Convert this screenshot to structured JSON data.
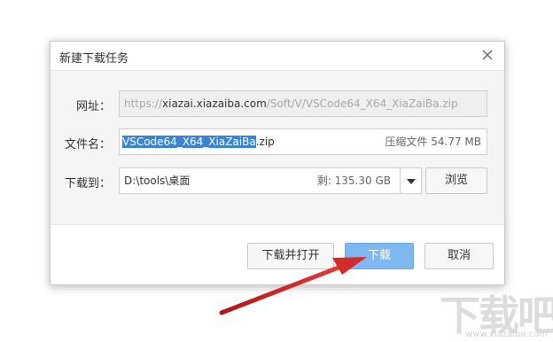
{
  "dialog": {
    "title": "新建下载任务"
  },
  "url_row": {
    "label": "网址：",
    "scheme": "https://",
    "host": "xiazai.xiazaiba.com",
    "path": "/Soft/V/VSCode64_X64_XiaZaiBa.zip"
  },
  "filename_row": {
    "label": "文件名：",
    "name_selected": "VSCode64_X64_XiaZaiBa",
    "extension": ".zip",
    "file_info": "压缩文件 54.77 MB"
  },
  "saveto_row": {
    "label": "下载到：",
    "path": "D:\\tools\\桌面",
    "free_space": "剩: 135.30 GB",
    "browse_label": "浏览"
  },
  "buttons": {
    "download_open": "下载并打开",
    "download": "下载",
    "cancel": "取消"
  },
  "watermark": {
    "big": "下载吧",
    "small": "www.xiazaiba.com"
  },
  "colors": {
    "primary_button": "#7fb7f0",
    "selection": "#3b84d4",
    "arrow": "#d42a2a"
  }
}
